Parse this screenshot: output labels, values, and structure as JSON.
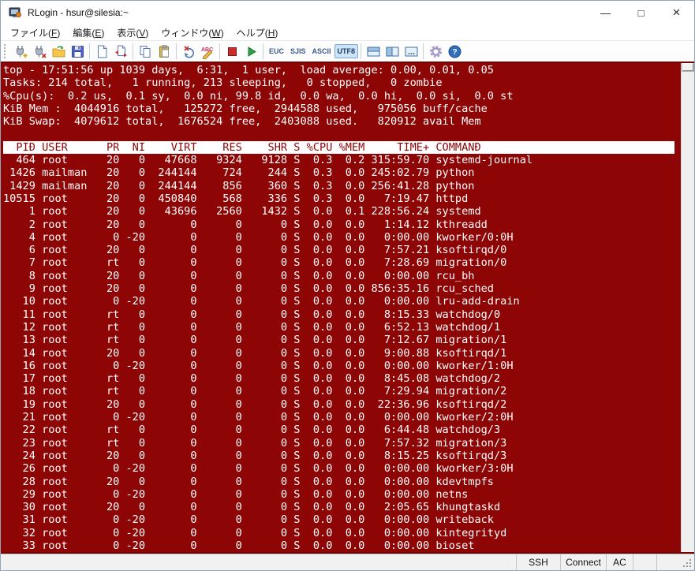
{
  "window": {
    "title": "RLogin - hsur@silesia:~",
    "controls": {
      "minimize": "—",
      "maximize": "□",
      "close": "×"
    }
  },
  "menu": {
    "items": [
      "ファイル(F)",
      "編集(E)",
      "表示(V)",
      "ウィンドウ(W)",
      "ヘルプ(H)"
    ]
  },
  "toolbar": {
    "button_names": [
      "new-connection",
      "disconnect",
      "open",
      "save",
      "new-document",
      "file-transfer",
      "copy",
      "paste",
      "clear-screen",
      "text-abc",
      "stop",
      "start",
      "charset-euc",
      "charset-sjis",
      "charset-ascii",
      "charset-utf8",
      "split-horizontal",
      "split-vertical",
      "new-window",
      "settings",
      "help"
    ],
    "charsets": [
      "EUC",
      "SJIS",
      "ASCII",
      "UTF8"
    ],
    "active_charset": "UTF8"
  },
  "terminal": {
    "colors": {
      "background": "#8e0505",
      "foreground": "#ffffff",
      "header_background": "#ffffff",
      "header_foreground": "#8e0505"
    },
    "summary_lines": [
      "top - 17:51:56 up 1039 days,  6:31,  1 user,  load average: 0.00, 0.01, 0.05",
      "Tasks: 214 total,   1 running, 213 sleeping,   0 stopped,   0 zombie",
      "%Cpu(s):  0.2 us,  0.1 sy,  0.0 ni, 99.8 id,  0.0 wa,  0.0 hi,  0.0 si,  0.0 st",
      "KiB Mem :  4044916 total,   125272 free,  2944588 used,   975056 buff/cache",
      "KiB Swap:  4079612 total,  1676524 free,  2403088 used.   820912 avail Mem",
      ""
    ],
    "process_table": {
      "header": {
        "pid": "PIÐ",
        "user": "USER",
        "pr": "PR",
        "ni": "NI",
        "virt": "VIRT",
        "res": "RES",
        "shr": "SHR",
        "s": "S",
        "cpu": "%CPU",
        "mem": "%MEM",
        "time": "TIME+",
        "cmd": "COMMANÐ"
      },
      "rows": [
        {
          "pid": "464",
          "user": "root",
          "pr": "20",
          "ni": "0",
          "virt": "47668",
          "res": "9324",
          "shr": "9128",
          "s": "S",
          "cpu": "0.3",
          "mem": "0.2",
          "time": "315:59.70",
          "cmd": "systemd-journal"
        },
        {
          "pid": "1426",
          "user": "mailman",
          "pr": "20",
          "ni": "0",
          "virt": "244144",
          "res": "724",
          "shr": "244",
          "s": "S",
          "cpu": "0.3",
          "mem": "0.0",
          "time": "245:02.79",
          "cmd": "python"
        },
        {
          "pid": "1429",
          "user": "mailman",
          "pr": "20",
          "ni": "0",
          "virt": "244144",
          "res": "856",
          "shr": "360",
          "s": "S",
          "cpu": "0.3",
          "mem": "0.0",
          "time": "256:41.28",
          "cmd": "python"
        },
        {
          "pid": "10515",
          "user": "root",
          "pr": "20",
          "ni": "0",
          "virt": "450840",
          "res": "568",
          "shr": "336",
          "s": "S",
          "cpu": "0.3",
          "mem": "0.0",
          "time": "7:19.47",
          "cmd": "httpd"
        },
        {
          "pid": "1",
          "user": "root",
          "pr": "20",
          "ni": "0",
          "virt": "43696",
          "res": "2560",
          "shr": "1432",
          "s": "S",
          "cpu": "0.0",
          "mem": "0.1",
          "time": "228:56.24",
          "cmd": "systemd"
        },
        {
          "pid": "2",
          "user": "root",
          "pr": "20",
          "ni": "0",
          "virt": "0",
          "res": "0",
          "shr": "0",
          "s": "S",
          "cpu": "0.0",
          "mem": "0.0",
          "time": "1:14.12",
          "cmd": "kthreadd"
        },
        {
          "pid": "4",
          "user": "root",
          "pr": "0",
          "ni": "-20",
          "virt": "0",
          "res": "0",
          "shr": "0",
          "s": "S",
          "cpu": "0.0",
          "mem": "0.0",
          "time": "0:00.00",
          "cmd": "kworker/0:0H"
        },
        {
          "pid": "6",
          "user": "root",
          "pr": "20",
          "ni": "0",
          "virt": "0",
          "res": "0",
          "shr": "0",
          "s": "S",
          "cpu": "0.0",
          "mem": "0.0",
          "time": "7:57.21",
          "cmd": "ksoftirqd/0"
        },
        {
          "pid": "7",
          "user": "root",
          "pr": "rt",
          "ni": "0",
          "virt": "0",
          "res": "0",
          "shr": "0",
          "s": "S",
          "cpu": "0.0",
          "mem": "0.0",
          "time": "7:28.69",
          "cmd": "migration/0"
        },
        {
          "pid": "8",
          "user": "root",
          "pr": "20",
          "ni": "0",
          "virt": "0",
          "res": "0",
          "shr": "0",
          "s": "S",
          "cpu": "0.0",
          "mem": "0.0",
          "time": "0:00.00",
          "cmd": "rcu_bh"
        },
        {
          "pid": "9",
          "user": "root",
          "pr": "20",
          "ni": "0",
          "virt": "0",
          "res": "0",
          "shr": "0",
          "s": "S",
          "cpu": "0.0",
          "mem": "0.0",
          "time": "856:35.16",
          "cmd": "rcu_sched"
        },
        {
          "pid": "10",
          "user": "root",
          "pr": "0",
          "ni": "-20",
          "virt": "0",
          "res": "0",
          "shr": "0",
          "s": "S",
          "cpu": "0.0",
          "mem": "0.0",
          "time": "0:00.00",
          "cmd": "lru-add-drain"
        },
        {
          "pid": "11",
          "user": "root",
          "pr": "rt",
          "ni": "0",
          "virt": "0",
          "res": "0",
          "shr": "0",
          "s": "S",
          "cpu": "0.0",
          "mem": "0.0",
          "time": "8:15.33",
          "cmd": "watchdog/0"
        },
        {
          "pid": "12",
          "user": "root",
          "pr": "rt",
          "ni": "0",
          "virt": "0",
          "res": "0",
          "shr": "0",
          "s": "S",
          "cpu": "0.0",
          "mem": "0.0",
          "time": "6:52.13",
          "cmd": "watchdog/1"
        },
        {
          "pid": "13",
          "user": "root",
          "pr": "rt",
          "ni": "0",
          "virt": "0",
          "res": "0",
          "shr": "0",
          "s": "S",
          "cpu": "0.0",
          "mem": "0.0",
          "time": "7:12.67",
          "cmd": "migration/1"
        },
        {
          "pid": "14",
          "user": "root",
          "pr": "20",
          "ni": "0",
          "virt": "0",
          "res": "0",
          "shr": "0",
          "s": "S",
          "cpu": "0.0",
          "mem": "0.0",
          "time": "9:00.88",
          "cmd": "ksoftirqd/1"
        },
        {
          "pid": "16",
          "user": "root",
          "pr": "0",
          "ni": "-20",
          "virt": "0",
          "res": "0",
          "shr": "0",
          "s": "S",
          "cpu": "0.0",
          "mem": "0.0",
          "time": "0:00.00",
          "cmd": "kworker/1:0H"
        },
        {
          "pid": "17",
          "user": "root",
          "pr": "rt",
          "ni": "0",
          "virt": "0",
          "res": "0",
          "shr": "0",
          "s": "S",
          "cpu": "0.0",
          "mem": "0.0",
          "time": "8:45.08",
          "cmd": "watchdog/2"
        },
        {
          "pid": "18",
          "user": "root",
          "pr": "rt",
          "ni": "0",
          "virt": "0",
          "res": "0",
          "shr": "0",
          "s": "S",
          "cpu": "0.0",
          "mem": "0.0",
          "time": "7:29.94",
          "cmd": "migration/2"
        },
        {
          "pid": "19",
          "user": "root",
          "pr": "20",
          "ni": "0",
          "virt": "0",
          "res": "0",
          "shr": "0",
          "s": "S",
          "cpu": "0.0",
          "mem": "0.0",
          "time": "22:36.96",
          "cmd": "ksoftirqd/2"
        },
        {
          "pid": "21",
          "user": "root",
          "pr": "0",
          "ni": "-20",
          "virt": "0",
          "res": "0",
          "shr": "0",
          "s": "S",
          "cpu": "0.0",
          "mem": "0.0",
          "time": "0:00.00",
          "cmd": "kworker/2:0H"
        },
        {
          "pid": "22",
          "user": "root",
          "pr": "rt",
          "ni": "0",
          "virt": "0",
          "res": "0",
          "shr": "0",
          "s": "S",
          "cpu": "0.0",
          "mem": "0.0",
          "time": "6:44.48",
          "cmd": "watchdog/3"
        },
        {
          "pid": "23",
          "user": "root",
          "pr": "rt",
          "ni": "0",
          "virt": "0",
          "res": "0",
          "shr": "0",
          "s": "S",
          "cpu": "0.0",
          "mem": "0.0",
          "time": "7:57.32",
          "cmd": "migration/3"
        },
        {
          "pid": "24",
          "user": "root",
          "pr": "20",
          "ni": "0",
          "virt": "0",
          "res": "0",
          "shr": "0",
          "s": "S",
          "cpu": "0.0",
          "mem": "0.0",
          "time": "8:15.25",
          "cmd": "ksoftirqd/3"
        },
        {
          "pid": "26",
          "user": "root",
          "pr": "0",
          "ni": "-20",
          "virt": "0",
          "res": "0",
          "shr": "0",
          "s": "S",
          "cpu": "0.0",
          "mem": "0.0",
          "time": "0:00.00",
          "cmd": "kworker/3:0H"
        },
        {
          "pid": "28",
          "user": "root",
          "pr": "20",
          "ni": "0",
          "virt": "0",
          "res": "0",
          "shr": "0",
          "s": "S",
          "cpu": "0.0",
          "mem": "0.0",
          "time": "0:00.00",
          "cmd": "kdevtmpfs"
        },
        {
          "pid": "29",
          "user": "root",
          "pr": "0",
          "ni": "-20",
          "virt": "0",
          "res": "0",
          "shr": "0",
          "s": "S",
          "cpu": "0.0",
          "mem": "0.0",
          "time": "0:00.00",
          "cmd": "netns"
        },
        {
          "pid": "30",
          "user": "root",
          "pr": "20",
          "ni": "0",
          "virt": "0",
          "res": "0",
          "shr": "0",
          "s": "S",
          "cpu": "0.0",
          "mem": "0.0",
          "time": "2:05.65",
          "cmd": "khungtaskd"
        },
        {
          "pid": "31",
          "user": "root",
          "pr": "0",
          "ni": "-20",
          "virt": "0",
          "res": "0",
          "shr": "0",
          "s": "S",
          "cpu": "0.0",
          "mem": "0.0",
          "time": "0:00.00",
          "cmd": "writeback"
        },
        {
          "pid": "32",
          "user": "root",
          "pr": "0",
          "ni": "-20",
          "virt": "0",
          "res": "0",
          "shr": "0",
          "s": "S",
          "cpu": "0.0",
          "mem": "0.0",
          "time": "0:00.00",
          "cmd": "kintegrityd"
        },
        {
          "pid": "33",
          "user": "root",
          "pr": "0",
          "ni": "-20",
          "virt": "0",
          "res": "0",
          "shr": "0",
          "s": "S",
          "cpu": "0.0",
          "mem": "0.0",
          "time": "0:00.00",
          "cmd": "bioset"
        }
      ]
    }
  },
  "statusbar": {
    "cells": [
      "SSH",
      "Connect",
      "AC",
      "",
      ""
    ]
  }
}
